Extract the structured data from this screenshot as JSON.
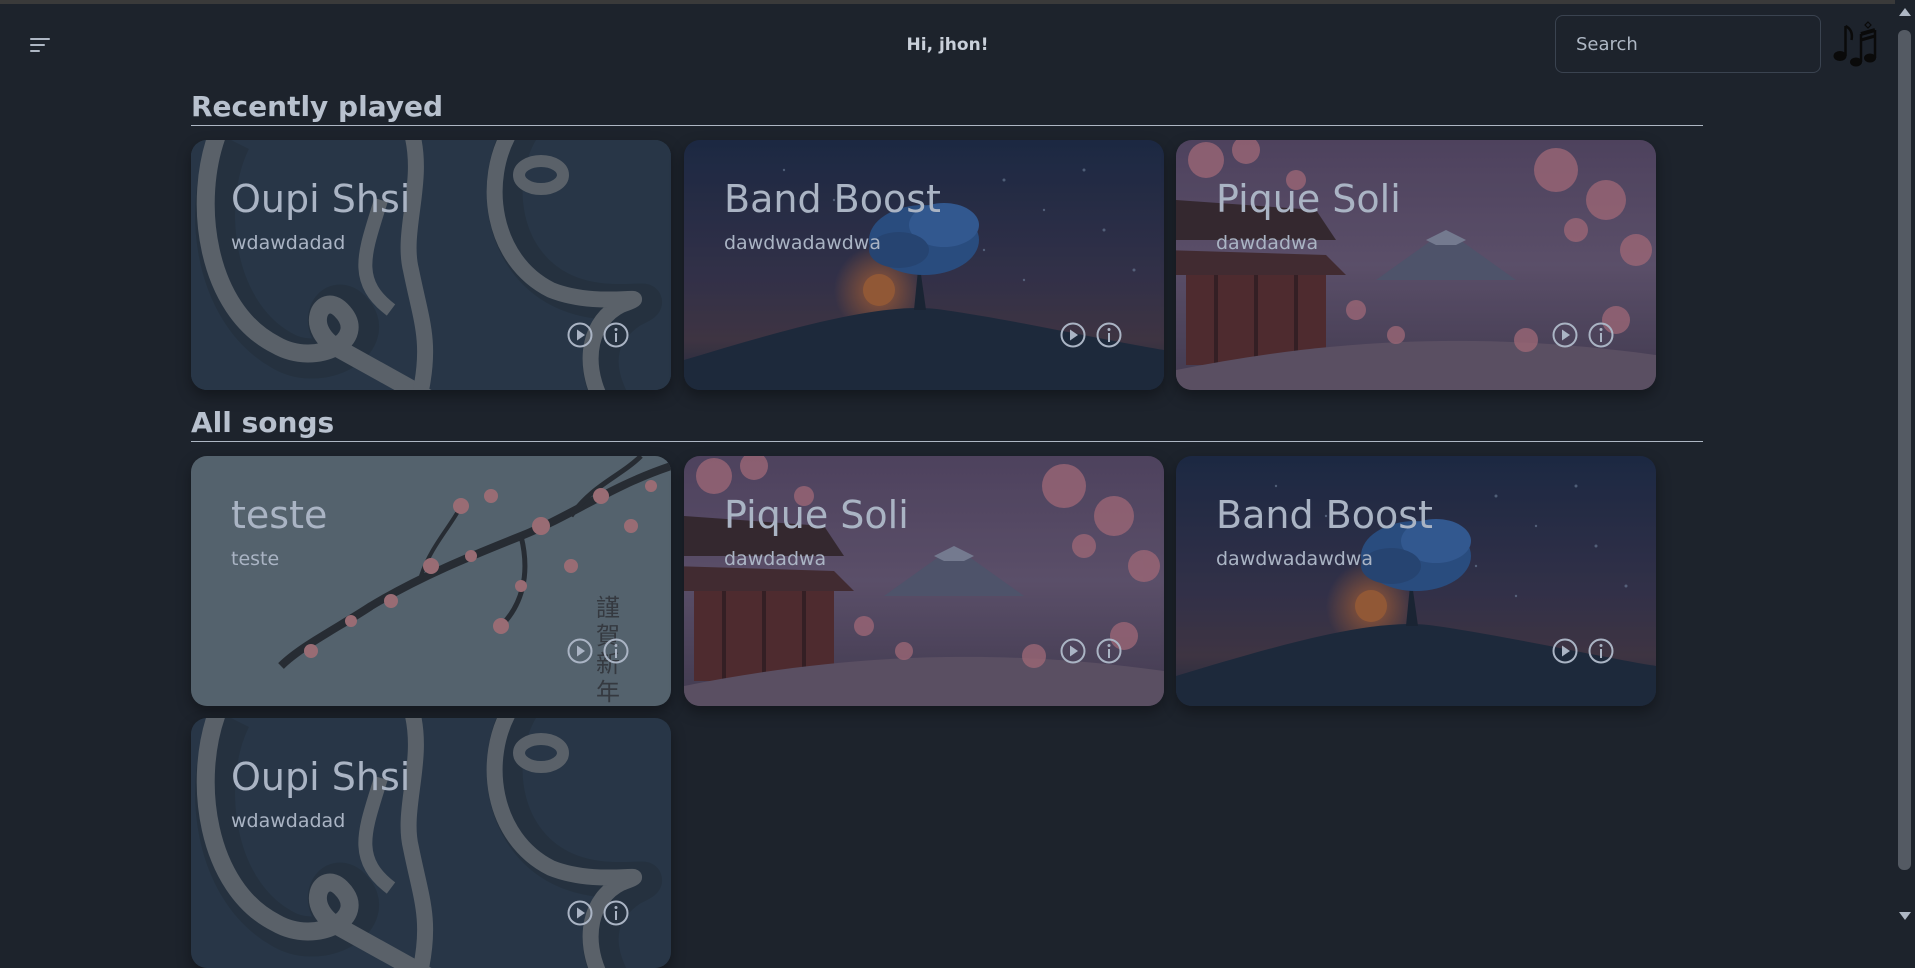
{
  "header": {
    "greeting": "Hi, jhon!",
    "search_placeholder": "Search",
    "menu_icon": "menu-icon",
    "logo_icon": "music-notes-icon"
  },
  "recently_played": {
    "title": "Recently played",
    "cards": [
      {
        "title": "Oupi Shsi",
        "artist": "wdawdadad",
        "art": "line-art-face"
      },
      {
        "title": "Band Boost",
        "artist": "dawdwadawdwa",
        "art": "night-sky-tree"
      },
      {
        "title": "Pique Soli",
        "artist": "dawdadwa",
        "art": "cherry-blossom-temple"
      }
    ]
  },
  "all_songs": {
    "title": "All songs",
    "cards": [
      {
        "title": "teste",
        "artist": "teste",
        "art": "cherry-branch-calligraphy"
      },
      {
        "title": "Pique Soli",
        "artist": "dawdadwa",
        "art": "cherry-blossom-temple"
      },
      {
        "title": "Band Boost",
        "artist": "dawdwadawdwa",
        "art": "night-sky-tree"
      },
      {
        "title": "Oupi Shsi",
        "artist": "wdawdadad",
        "art": "line-art-face"
      }
    ]
  },
  "colors": {
    "background": "#1d232c",
    "text": "#aeb7c4",
    "card_overlay": "#2a3340"
  }
}
